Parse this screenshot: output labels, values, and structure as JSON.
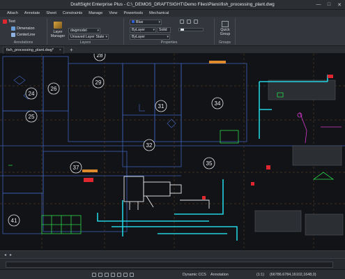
{
  "window": {
    "title": "DraftSight Enterprise Plus - C:\\_DEMOS_DRAFTSIGHT\\Demo Files\\Plans\\fish_processing_plant.dwg",
    "minimize": "—",
    "maximize": "□",
    "close": "✕"
  },
  "menu": [
    "Attach",
    "Annotate",
    "Sheet",
    "Constraints",
    "Manage",
    "View",
    "Powertools",
    "Mechanical"
  ],
  "ribbon": {
    "annotation": {
      "label": "Annotations",
      "text": "Text",
      "dimension": "Dimension",
      "centerline": "CenterLine"
    },
    "layers": {
      "label": "Layers",
      "manager_line1": "Layer",
      "manager_line2": "Manager",
      "layer_combo": "dwgmodel",
      "state_combo": "Unsaved Layer State"
    },
    "properties": {
      "label": "Properties",
      "color": "Blue",
      "linestyle": "ByLayer",
      "lineweight_label": "Solid",
      "lineweight": "ByLayer"
    },
    "groups": {
      "label": "Groups",
      "quick_line1": "Quick",
      "quick_line2": "Group"
    }
  },
  "document_tab": "fish_processing_plant.dwg*",
  "tab_plus": "+",
  "room_numbers": [
    "24",
    "25",
    "26",
    "29",
    "31",
    "32",
    "34",
    "35",
    "37",
    "41",
    "28"
  ],
  "status": {
    "dynamic_ccs": "Dynamic CCS",
    "annotation": "Annotation",
    "scale": "(1:1)",
    "coords": "(66786.6784,16102,1648,0)"
  },
  "colors": {
    "accent": "#4a90d9",
    "canvas": "#121316",
    "room_outline": "#3d5fb8",
    "pipe_cyan": "#22d3e0",
    "equipment_green": "#2bd94a",
    "magenta": "#d93ad0",
    "red": "#e0262f"
  }
}
